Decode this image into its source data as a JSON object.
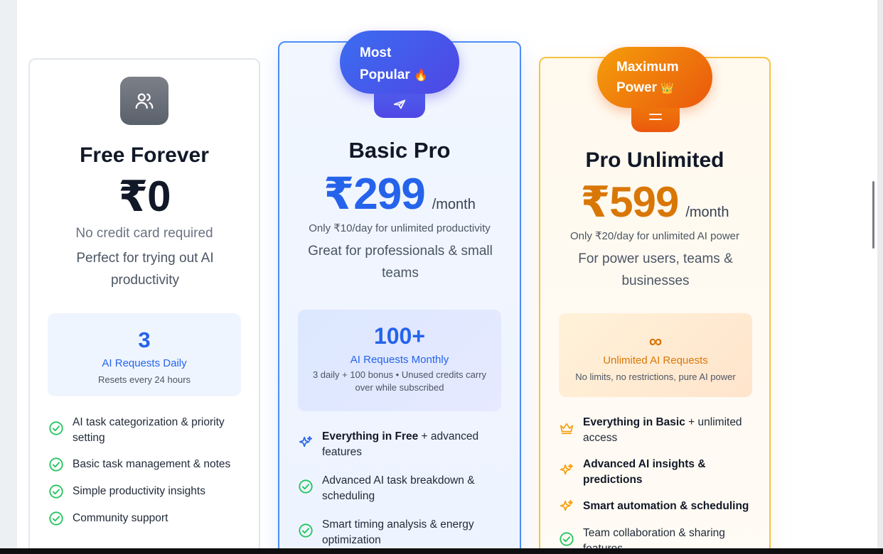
{
  "plans": {
    "free": {
      "title": "Free Forever",
      "price": "₹0",
      "note": "No credit card required",
      "description": "Perfect for trying out AI productivity",
      "icon": "users-icon",
      "quota": {
        "value": "3",
        "label": "AI Requests Daily",
        "sub": "Resets every 24 hours"
      },
      "features": [
        {
          "text": "AI task categorization & priority setting",
          "icon": "check-circle-icon"
        },
        {
          "text": "Basic task management & notes",
          "icon": "check-circle-icon"
        },
        {
          "text": "Simple productivity insights",
          "icon": "check-circle-icon"
        },
        {
          "text": "Community support",
          "icon": "check-circle-icon"
        }
      ]
    },
    "basic": {
      "badge_line1": "Most",
      "badge_line2": "Popular",
      "badge_emoji": "🔥",
      "title": "Basic Pro",
      "price": "₹299",
      "per": "/month",
      "note": "Only ₹10/day for unlimited productivity",
      "description": "Great for professionals & small teams",
      "icon": "send-icon",
      "quota": {
        "value": "100+",
        "label": "AI Requests Monthly",
        "sub": "3 daily + 100 bonus • Unused credits carry over while subscribed"
      },
      "features": [
        {
          "bold": "Everything in Free",
          "text": " + advanced features",
          "icon": "sparkle-icon"
        },
        {
          "text": "Advanced AI task breakdown & scheduling",
          "icon": "check-circle-icon"
        },
        {
          "text": "Smart timing analysis & energy optimization",
          "icon": "check-circle-icon"
        }
      ]
    },
    "pro": {
      "badge_line1": "Maximum",
      "badge_line2": "Power",
      "badge_emoji": "👑",
      "title": "Pro Unlimited",
      "price": "₹599",
      "per": "/month",
      "note": "Only ₹20/day for unlimited AI power",
      "description": "For power users, teams & businesses",
      "icon": "crown-icon",
      "quota": {
        "value": "∞",
        "label": "Unlimited AI Requests",
        "sub": "No limits, no restrictions, pure AI power"
      },
      "features": [
        {
          "bold": "Everything in Basic",
          "text": " + unlimited access",
          "icon": "crown-icon"
        },
        {
          "bold": "Advanced AI insights & predictions",
          "text": "",
          "icon": "sparkle-icon"
        },
        {
          "bold": "Smart automation & scheduling",
          "text": "",
          "icon": "sparkle-icon"
        },
        {
          "text": "Team collaboration & sharing features",
          "icon": "check-circle-icon"
        }
      ]
    }
  },
  "colors": {
    "blue_accent": "#2563eb",
    "orange_accent": "#d97706",
    "check_green": "#22c55e"
  }
}
